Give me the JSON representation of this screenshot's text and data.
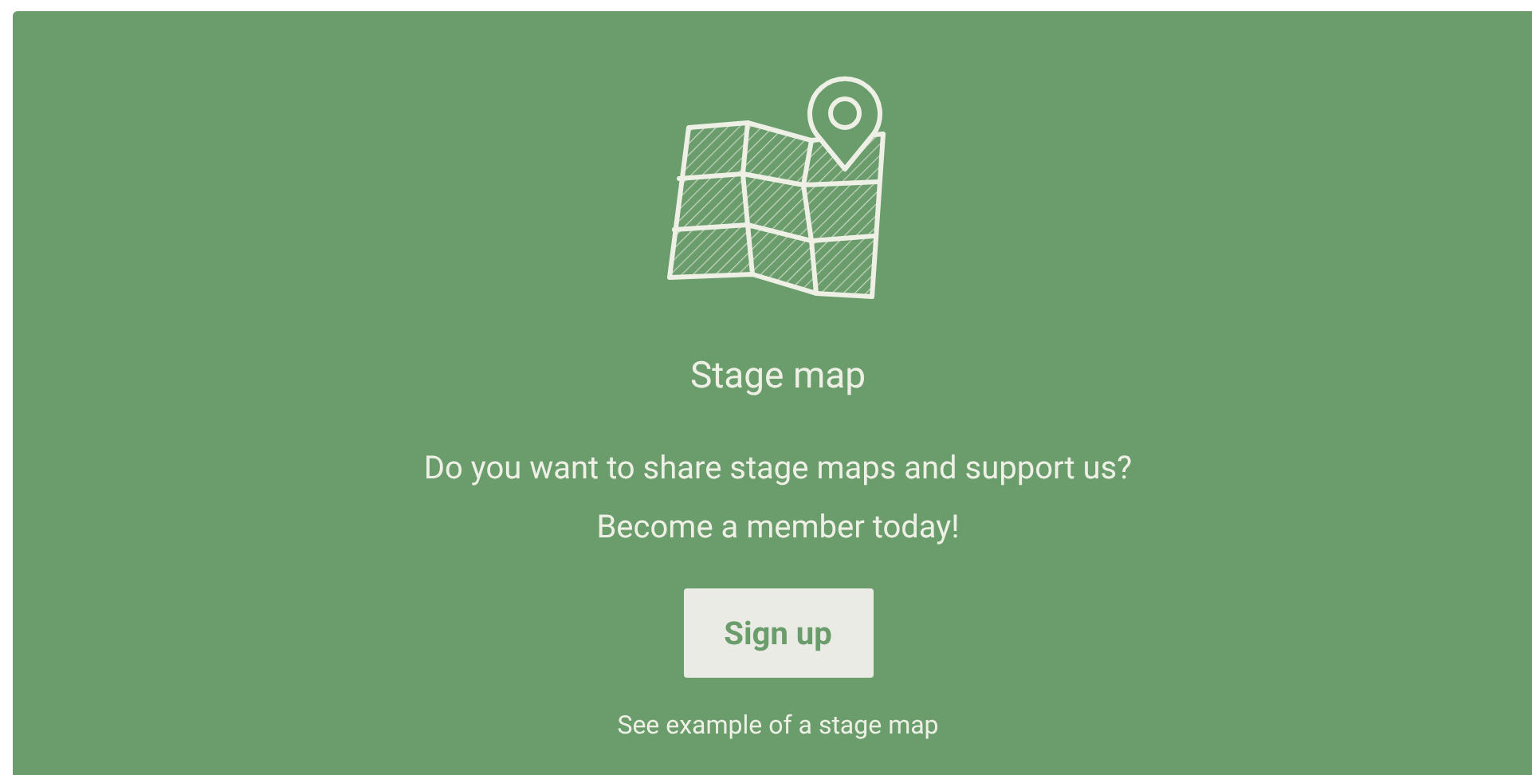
{
  "panel": {
    "title": "Stage map",
    "message": [
      "Do you want to share stage maps and support us?",
      "Become a member today!"
    ],
    "button": "Sign up",
    "link": "See example of a stage map"
  }
}
